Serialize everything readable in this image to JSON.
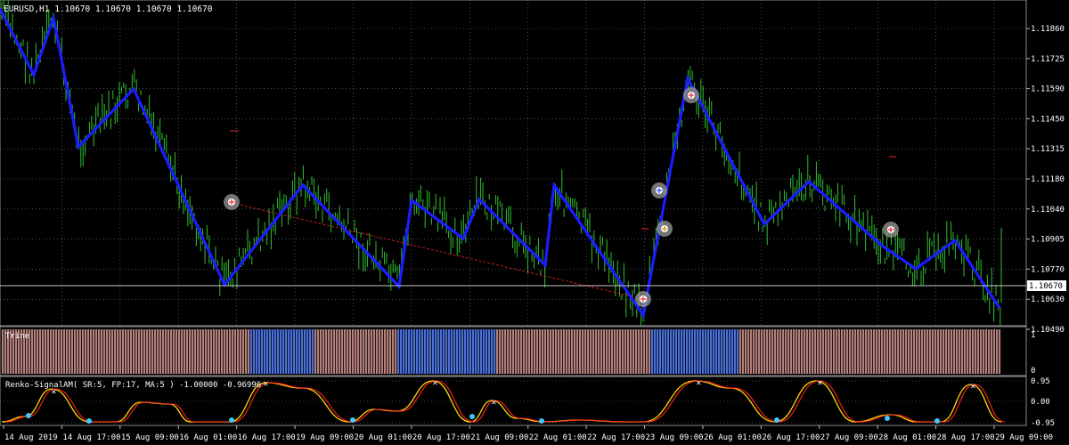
{
  "main_panel": {
    "header": "EURUSD,H1  1.10670 1.10670 1.10670 1.10670",
    "current_price_label": "1.10670",
    "price_labels": [
      "1.11860",
      "1.11725",
      "1.11590",
      "1.11450",
      "1.11315",
      "1.11180",
      "1.11040",
      "1.10905",
      "1.10770",
      "1.10630",
      "1.10490"
    ]
  },
  "trine_panel": {
    "label": "Trine",
    "scale_top": "1",
    "scale_bottom": "0"
  },
  "renko_panel": {
    "label": "Renko-SignalAM( SR:5, FP:17, MA:5 ) -1.00000 -0.96996",
    "scale_top": "0.95",
    "scale_mid": "0.00",
    "scale_bottom": "-0.95"
  },
  "time_axis": {
    "labels": [
      "14 Aug 2019",
      "14 Aug 17:00",
      "15 Aug 09:00",
      "16 Aug 01:00",
      "16 Aug 17:00",
      "19 Aug 09:00",
      "20 Aug 01:00",
      "20 Aug 17:00",
      "21 Aug 09:00",
      "22 Aug 01:00",
      "22 Aug 17:00",
      "23 Aug 09:00",
      "26 Aug 01:00",
      "26 Aug 17:00",
      "27 Aug 09:00",
      "28 Aug 01:00",
      "28 Aug 17:00",
      "29 Aug 09:00"
    ]
  },
  "colors": {
    "background": "#000000",
    "grid": "#7a8294",
    "bars": "#2fc02f",
    "zigzag": "#1c1cff",
    "trendline": "#c02020",
    "trine_a": "#b27f7a",
    "trine_b": "#4a6fd8",
    "osc_main": "#ffd700",
    "osc_signal": "#ff2020"
  }
}
